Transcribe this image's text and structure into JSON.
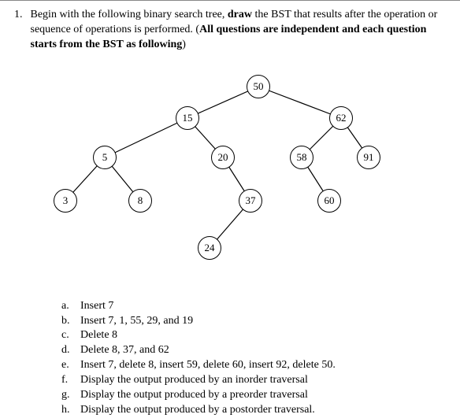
{
  "question": {
    "number": "1.",
    "text_part1": "Begin with the following binary search tree, ",
    "bold1": "draw",
    "text_part2": " the BST that results after the operation or sequence of operations is performed. (",
    "bold2": "All questions are independent and each question starts from the BST as following",
    "text_part3": ")"
  },
  "nodes": {
    "n50": "50",
    "n15": "15",
    "n62": "62",
    "n5": "5",
    "n20": "20",
    "n58": "58",
    "n91": "91",
    "n3": "3",
    "n8": "8",
    "n37": "37",
    "n60": "60",
    "n24": "24"
  },
  "subs": {
    "a": {
      "letter": "a.",
      "text": "Insert 7"
    },
    "b": {
      "letter": "b.",
      "text": "Insert 7, 1, 55, 29, and 19"
    },
    "c": {
      "letter": "c.",
      "text": "Delete 8"
    },
    "d": {
      "letter": "d.",
      "text": "Delete 8, 37, and 62"
    },
    "e": {
      "letter": "e.",
      "text": "Insert 7, delete 8, insert 59, delete 60, insert 92, delete 50."
    },
    "f": {
      "letter": "f.",
      "text": "Display the output produced by an inorder traversal"
    },
    "g": {
      "letter": "g.",
      "text": "Display the output produced by a preorder traversal"
    },
    "h": {
      "letter": "h.",
      "text": "Display the output produced by a postorder traversal."
    }
  }
}
